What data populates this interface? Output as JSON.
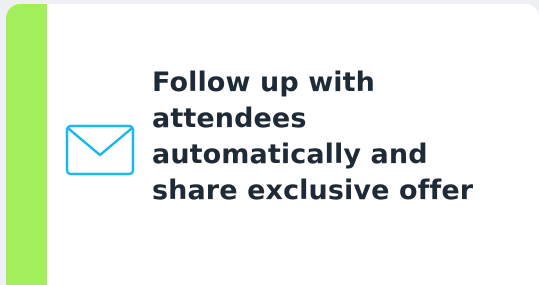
{
  "card": {
    "accent_color": "#a3ef5b",
    "icon": "mail-envelope-icon",
    "icon_color": "#1cb8ec",
    "message": "Follow up with attendees automatically and share exclusive offer"
  }
}
